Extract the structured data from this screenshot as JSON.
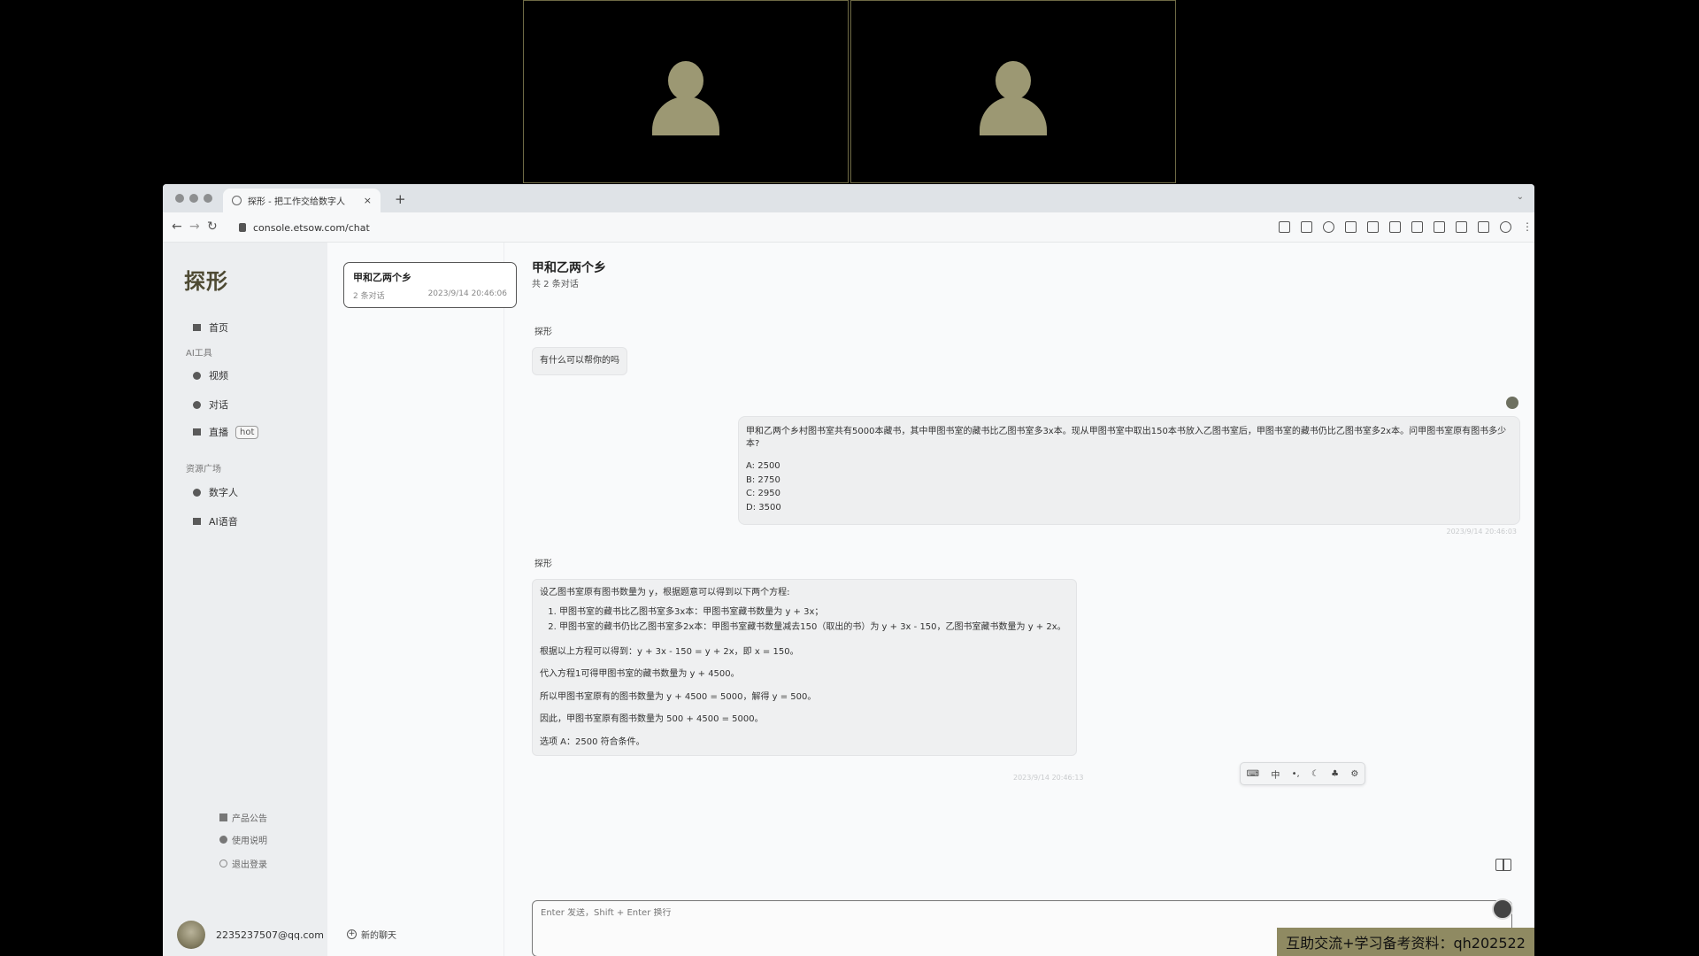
{
  "browser": {
    "tab_title": "探形 - 把工作交给数字人",
    "tab_close": "×",
    "new_tab": "+",
    "url": "console.etsow.com/chat",
    "back": "←",
    "forward": "→",
    "reload": "↻"
  },
  "sidebar": {
    "logo": "探形",
    "home": "首页",
    "section_ai_tools": "AI工具",
    "video": "视频",
    "chat": "对话",
    "live": "直播",
    "hot_badge": "hot",
    "section_resources": "资源广场",
    "digital_human": "数字人",
    "ai_voice": "AI语音",
    "announcement": "产品公告",
    "manual": "使用说明",
    "logout": "退出登录",
    "user_email": "2235237507@qq.com"
  },
  "conversations": {
    "items": [
      {
        "title": "甲和乙两个乡",
        "count": "2 条对话",
        "time": "2023/9/14 20:46:06"
      }
    ],
    "new_chat": "新的聊天"
  },
  "chat": {
    "title": "甲和乙两个乡",
    "subtitle": "共 2 条对话",
    "bot_name": "探形",
    "greeting": "有什么可以帮你的吗",
    "user_question": "甲和乙两个乡村图书室共有5000本藏书，其中甲图书室的藏书比乙图书室多3x本。现从甲图书室中取出150本书放入乙图书室后，甲图书室的藏书仍比乙图书室多2x本。问甲图书室原有图书多少本?",
    "options": [
      "A:  2500",
      "B:  2750",
      "C:  2950",
      "D:  3500"
    ],
    "user_time": "2023/9/14 20:46:03",
    "answer": {
      "intro": "设乙图书室原有图书数量为 y，根据题意可以得到以下两个方程:",
      "eq1": "甲图书室的藏书比乙图书室多3x本：甲图书室藏书数量为 y + 3x；",
      "eq2": "甲图书室的藏书仍比乙图书室多2x本：甲图书室藏书数量减去150（取出的书）为 y + 3x - 150，乙图书室藏书数量为 y + 2x。",
      "p1": "根据以上方程可以得到：y + 3x - 150 = y + 2x，即 x = 150。",
      "p2": "代入方程1可得甲图书室的藏书数量为 y + 4500。",
      "p3": "所以甲图书室原有的图书数量为 y + 4500 = 5000，解得 y = 500。",
      "p4": "因此，甲图书室原有图书数量为 500 + 4500 = 5000。",
      "p5": "选项 A：2500 符合条件。"
    },
    "answer_time": "2023/9/14 20:46:13",
    "input_placeholder": "Enter 发送，Shift + Enter 换行"
  },
  "floating_tools": [
    "中",
    "•,",
    "◔"
  ],
  "watermark": "互助交流+学习备考资料：qh202522"
}
